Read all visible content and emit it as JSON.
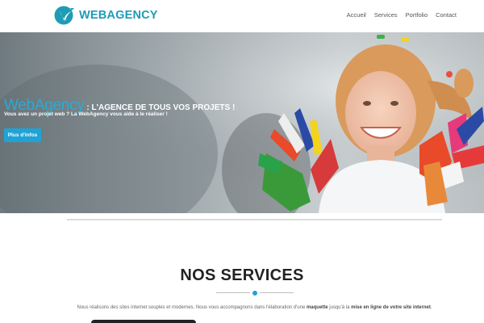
{
  "header": {
    "logo_text": "WEBAGENCY",
    "nav": [
      "Accueil",
      "Services",
      "Portfolio",
      "Contact"
    ]
  },
  "hero": {
    "brand": "WebAgency",
    "tagline": ": L'AGENCE DE TOUS VOS PROJETS !",
    "subtitle": "Vous avez un projet web ? La WebAgency vous aide à le réaliser !",
    "button_label": "Plus d'infos"
  },
  "services": {
    "title": "NOS SERVICES",
    "text_parts": [
      "Nous réalisons des sites internet souples et modernes. Nous vous accompagnons dans l'élaboration d'une ",
      "maquette",
      " jusqu'à la ",
      "mise en ligne de votre site internet",
      "."
    ]
  },
  "colors": {
    "brand": "#1e9cb4",
    "accent": "#1fa3d6",
    "hero_brand": "#2aaad4"
  },
  "icons": {
    "logo_mark": "bird-in-circle-icon"
  }
}
